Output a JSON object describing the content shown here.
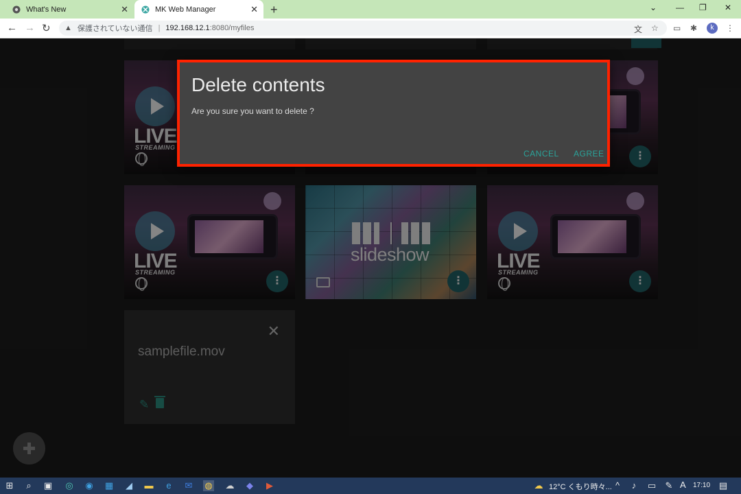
{
  "browser": {
    "tabs": [
      {
        "label": "What's New",
        "active": false
      },
      {
        "label": "MK Web Manager",
        "active": true
      }
    ],
    "address": {
      "security_label": "保護されていない通信",
      "host": "192.168.12.1",
      "path": ":8080/myfiles"
    },
    "profile_initial": "k"
  },
  "grid": {
    "cards": [
      {
        "type": "live",
        "logo_text": "LIVE",
        "logo_subtext": "STREAMING"
      },
      {
        "type": "live",
        "logo_text": "LIVE",
        "logo_subtext": "STREAMING"
      },
      {
        "type": "live",
        "logo_text": "LIVE",
        "logo_subtext": "STREAMING"
      },
      {
        "type": "slideshow",
        "logo_text": "slideshow"
      },
      {
        "type": "live",
        "logo_text": "LIVE",
        "logo_subtext": "STREAMING"
      }
    ],
    "file_card": {
      "filename": "samplefile.mov"
    }
  },
  "dialog": {
    "title": "Delete contents",
    "message": "Are you sure you want to delete ?",
    "cancel_label": "CANCEL",
    "agree_label": "AGREE",
    "highlight_color": "#ff2200",
    "accent_color": "#2aa39a"
  },
  "taskbar": {
    "weather": "12°C くもり時々...",
    "ime": "A",
    "time": "17:10"
  }
}
